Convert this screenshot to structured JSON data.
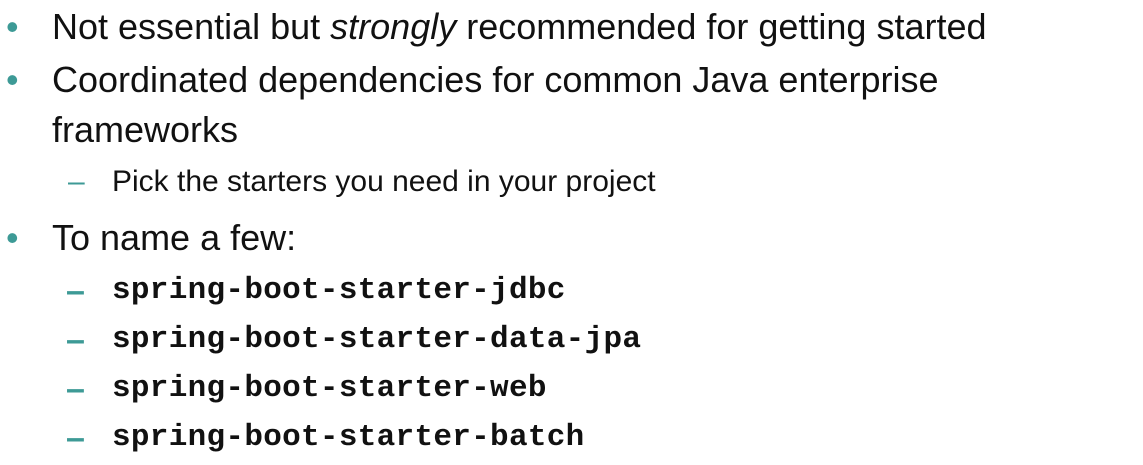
{
  "bullets": [
    {
      "marker": "•",
      "text_before": "Not essential but ",
      "text_emphasis": "strongly",
      "text_after": " recommended for getting started"
    },
    {
      "marker": "•",
      "line1": "Coordinated dependencies for common Java enterprise",
      "line2": "frameworks",
      "sub": {
        "marker": "–",
        "text": "Pick the starters you need in your project"
      }
    },
    {
      "marker": "•",
      "text": "To name a few:",
      "starters": [
        {
          "marker": "–",
          "text": "spring-boot-starter-jdbc"
        },
        {
          "marker": "–",
          "text": "spring-boot-starter-data-jpa"
        },
        {
          "marker": "–",
          "text": "spring-boot-starter-web"
        },
        {
          "marker": "–",
          "text": "spring-boot-starter-batch"
        }
      ]
    }
  ],
  "colors": {
    "marker": "#3d9a96",
    "text": "#111111",
    "background": "#ffffff"
  }
}
